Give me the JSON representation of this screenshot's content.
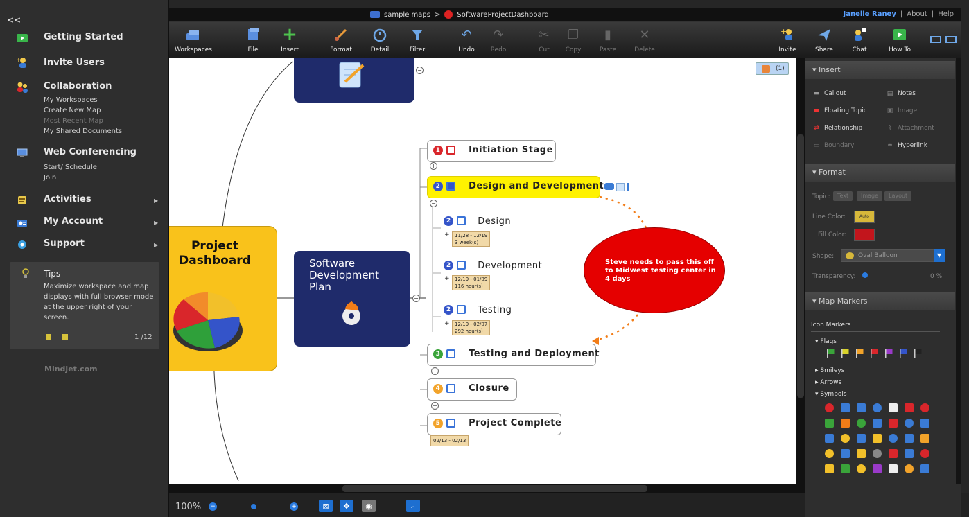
{
  "sidebar": {
    "collapse_label": "<<",
    "items": [
      {
        "label": "Getting Started"
      },
      {
        "label": "Invite Users"
      },
      {
        "label": "Collaboration"
      },
      {
        "label": "Web Conferencing"
      },
      {
        "label": "Activities"
      },
      {
        "label": "My Account"
      },
      {
        "label": "Support"
      }
    ],
    "collaboration_links": [
      "My Workspaces",
      "Create New Map",
      "Most Recent Map",
      "My Shared Documents"
    ],
    "webconf_links": [
      "Start/ Schedule",
      "Join"
    ],
    "tips": {
      "title": "Tips",
      "body": "Maximize workspace and map displays with full browser mode at the upper right of your screen.",
      "page": "1 /12"
    },
    "footer": "Mindjet.com"
  },
  "topbar": {
    "breadcrumb_1": "sample maps",
    "separator": ">",
    "breadcrumb_2": "SoftwareProjectDashboard",
    "user": "Janelle Raney",
    "about": "About",
    "help": "Help",
    "divider": "|"
  },
  "toolbar": {
    "left": [
      "Workspaces",
      "File",
      "Insert",
      "Format",
      "Detail",
      "Filter",
      "Undo",
      "Redo",
      "Cut",
      "Copy",
      "Paste",
      "Delete"
    ],
    "right": [
      "Invite",
      "Share",
      "Chat",
      "How To"
    ]
  },
  "map": {
    "presence_count": "(1)",
    "central": {
      "title": "Project Dashboard"
    },
    "main_topic": {
      "title": "Software Development Plan"
    },
    "stages": [
      {
        "num": "1",
        "label": "Initiation Stage",
        "color": "#d9262b"
      },
      {
        "num": "2",
        "label": "Design and Development",
        "color": "#3454c9"
      },
      {
        "num": "3",
        "label": "Testing and Deployment",
        "color": "#3aa43a"
      },
      {
        "num": "4",
        "label": "Closure",
        "color": "#f2a32a"
      },
      {
        "num": "5",
        "label": "Project Complete",
        "color": "#f2a32a"
      }
    ],
    "subtopics": [
      {
        "num": "2",
        "label": "Design",
        "dates": "11/28 - 12/19",
        "effort": "3 week(s)"
      },
      {
        "num": "2",
        "label": "Development",
        "dates": "12/19 - 01/09",
        "effort": "116 hour(s)"
      },
      {
        "num": "2",
        "label": "Testing",
        "dates": "12/19 - 02/07",
        "effort": "292 hour(s)"
      }
    ],
    "complete_dates": "02/13 - 02/13",
    "callout": "Steve needs to pass this off to Midwest testing center in 4 days",
    "expander_plus": "+",
    "expander_minus": "−"
  },
  "right_panel": {
    "insert_header": "Insert",
    "insert_items": [
      "Callout",
      "Notes",
      "Floating Topic",
      "Image",
      "Relationship",
      "Attachment",
      "Boundary",
      "Hyperlink"
    ],
    "format_header": "Format",
    "topic_label": "Topic:",
    "topic_tabs": [
      "Text",
      "Image",
      "Layout"
    ],
    "line_color_label": "Line Color:",
    "line_color_value": "Auto",
    "fill_color_label": "Fill Color:",
    "shape_label": "Shape:",
    "shape_value": "Oval Balloon",
    "transparency_label": "Transparency:",
    "transparency_value": "0 %",
    "markers_header": "Map Markers",
    "icon_markers_label": "Icon Markers",
    "groups": [
      "Flags",
      "Smileys",
      "Arrows",
      "Symbols"
    ],
    "flag_colors": [
      "#3aa43a",
      "#d8d22a",
      "#f2a32a",
      "#d9262b",
      "#9a3ac9",
      "#3454c9",
      "#222222"
    ],
    "colors": {
      "line_color": "#d7b83a",
      "fill_color": "#c2151c",
      "callout_fill": "#e50000"
    }
  },
  "bottom": {
    "zoom": "100%"
  }
}
